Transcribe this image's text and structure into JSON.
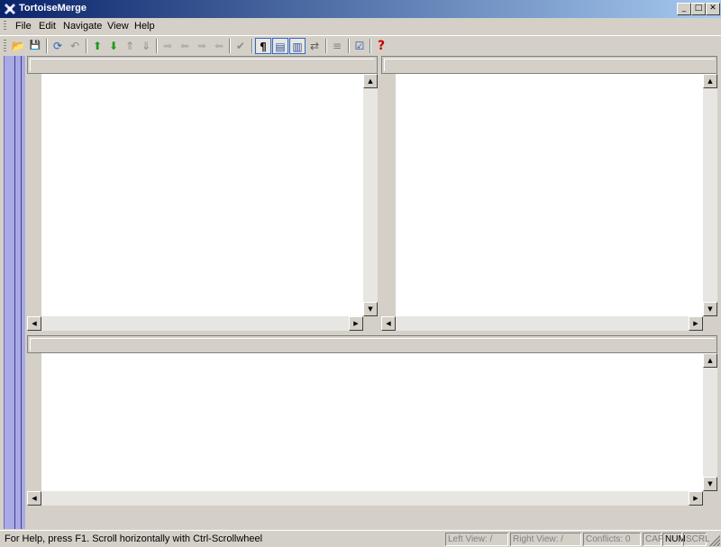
{
  "window": {
    "title": "TortoiseMerge",
    "minimize_label": "_",
    "maximize_label": "□",
    "close_label": "✕"
  },
  "menu": {
    "items": [
      "File",
      "Edit",
      "Navigate",
      "View",
      "Help"
    ]
  },
  "toolbar": {
    "buttons": [
      {
        "name": "open-icon",
        "glyph": "📂"
      },
      {
        "name": "save-icon",
        "glyph": "💾"
      },
      {
        "name": "reload-icon",
        "glyph": "⟳"
      },
      {
        "name": "undo-icon",
        "glyph": "↶"
      },
      {
        "name": "next-difference-icon",
        "glyph": "⬆"
      },
      {
        "name": "previous-difference-icon",
        "glyph": "⬇"
      },
      {
        "name": "first-difference-icon",
        "glyph": "⇑"
      },
      {
        "name": "last-difference-icon",
        "glyph": "⇓"
      },
      {
        "name": "use-left-icon",
        "glyph": "➡"
      },
      {
        "name": "use-right-icon",
        "glyph": "⬅"
      },
      {
        "name": "use-left-block-icon",
        "glyph": "➡"
      },
      {
        "name": "use-right-block-icon",
        "glyph": "⬅"
      },
      {
        "name": "mark-resolved-icon",
        "glyph": "✔"
      },
      {
        "name": "whitespace-icon",
        "glyph": "¶"
      },
      {
        "name": "one-pane-icon",
        "glyph": "▤"
      },
      {
        "name": "two-pane-icon",
        "glyph": "▥"
      },
      {
        "name": "switch-icon",
        "glyph": "⇄"
      },
      {
        "name": "line-diff-icon",
        "glyph": "≡"
      },
      {
        "name": "settings-icon",
        "glyph": "☑"
      },
      {
        "name": "help-icon",
        "glyph": "?"
      }
    ],
    "colors": {
      "arrow_green": "#1f9a1f",
      "arrow_gray": "#8c8c8c",
      "help_red": "#cc0000",
      "pressed_border": "#316ac5"
    }
  },
  "status": {
    "help_text": "For Help, press F1. Scroll horizontally with Ctrl-Scrollwheel",
    "left_view": "Left View: /",
    "right_view": "Right View: /",
    "conflicts": "Conflicts: 0",
    "cap": "CAP",
    "num": "NUM",
    "scrl": "SCRL"
  },
  "scroll": {
    "left": "◀",
    "right": "▶",
    "up": "▲",
    "down": "▼"
  },
  "colors": {
    "title_start": "#0a246a",
    "title_end": "#a6caf0",
    "chrome": "#d4d0c8",
    "location_bar": "#a9a9e8"
  }
}
